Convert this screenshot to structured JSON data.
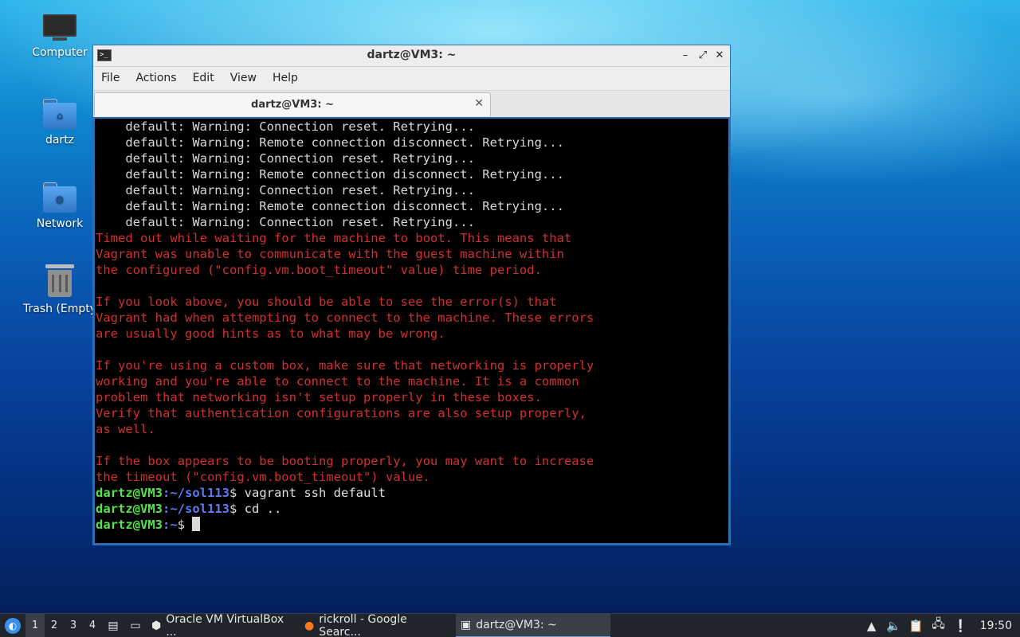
{
  "desktop": {
    "icons": [
      {
        "label": "Computer",
        "icon": "computer-icon"
      },
      {
        "label": "dartz",
        "icon": "home-folder-icon"
      },
      {
        "label": "Network",
        "icon": "network-folder-icon"
      },
      {
        "label": "Trash (Empty)",
        "icon": "trash-icon"
      }
    ]
  },
  "window": {
    "title": "dartz@VM3: ~",
    "menu": [
      "File",
      "Actions",
      "Edit",
      "View",
      "Help"
    ],
    "tab_label": "dartz@VM3: ~",
    "controls": {
      "minimize": "–",
      "maximize": "⤢",
      "close": "✕"
    }
  },
  "terminal": {
    "warnings": [
      "    default: Warning: Connection reset. Retrying...",
      "    default: Warning: Remote connection disconnect. Retrying...",
      "    default: Warning: Connection reset. Retrying...",
      "    default: Warning: Remote connection disconnect. Retrying...",
      "    default: Warning: Connection reset. Retrying...",
      "    default: Warning: Remote connection disconnect. Retrying...",
      "    default: Warning: Connection reset. Retrying..."
    ],
    "errors": [
      "Timed out while waiting for the machine to boot. This means that",
      "Vagrant was unable to communicate with the guest machine within",
      "the configured (\"config.vm.boot_timeout\" value) time period.",
      "",
      "If you look above, you should be able to see the error(s) that",
      "Vagrant had when attempting to connect to the machine. These errors",
      "are usually good hints as to what may be wrong.",
      "",
      "If you're using a custom box, make sure that networking is properly",
      "working and you're able to connect to the machine. It is a common",
      "problem that networking isn't setup properly in these boxes.",
      "Verify that authentication configurations are also setup properly,",
      "as well.",
      "",
      "If the box appears to be booting properly, you may want to increase",
      "the timeout (\"config.vm.boot_timeout\") value."
    ],
    "prompts": [
      {
        "user": "dartz@VM3",
        "path": ":~/sol113",
        "sym": "$",
        "cmd": " vagrant ssh default"
      },
      {
        "user": "dartz@VM3",
        "path": ":~/sol113",
        "sym": "$",
        "cmd": " cd .."
      },
      {
        "user": "dartz@VM3",
        "path": ":~",
        "sym": "$",
        "cmd": " "
      }
    ]
  },
  "taskbar": {
    "workspaces": [
      "1",
      "2",
      "3",
      "4"
    ],
    "tasks": [
      {
        "label": "Oracle VM VirtualBox ...",
        "icon": "virtualbox-icon"
      },
      {
        "label": "rickroll - Google Searc...",
        "icon": "firefox-icon"
      },
      {
        "label": "dartz@VM3: ~",
        "icon": "terminal-icon"
      }
    ],
    "clock": "19:50"
  }
}
